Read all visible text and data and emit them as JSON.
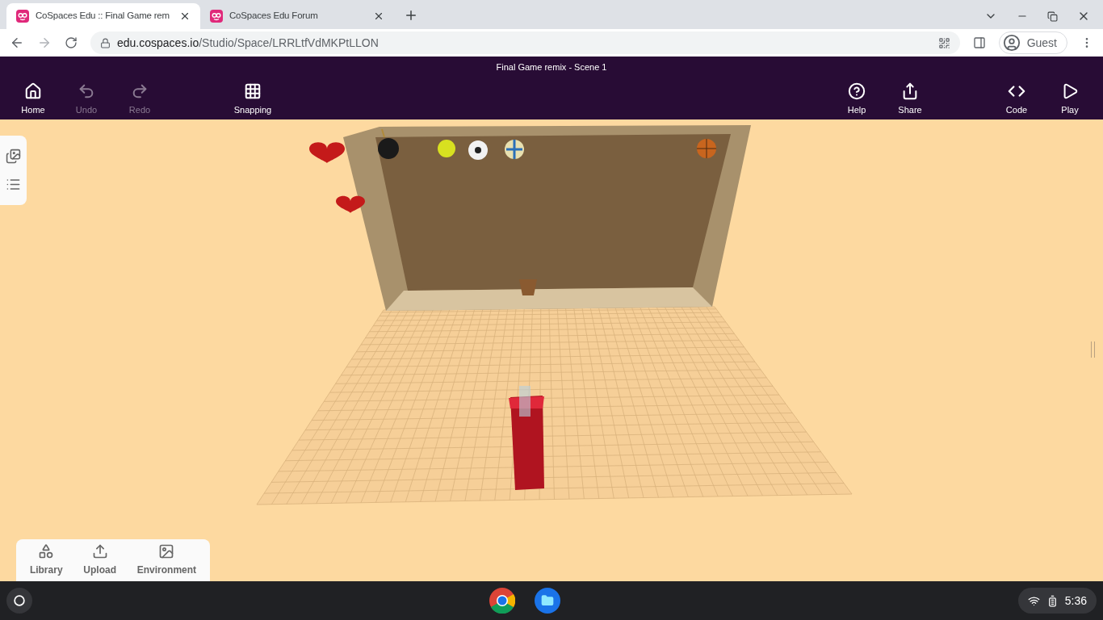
{
  "browser": {
    "tabs": [
      {
        "title": "CoSpaces Edu :: Final Game rem",
        "selected": true
      },
      {
        "title": "CoSpaces Edu Forum",
        "selected": false
      }
    ],
    "address": {
      "host": "edu.cospaces.io",
      "path": "/Studio/Space/LRRLtfVdMKPtLLON"
    },
    "profile": "Guest"
  },
  "app": {
    "title": "Final Game remix - Scene 1",
    "toolbar": [
      {
        "kind": "home",
        "label": "Home",
        "disabled": false
      },
      {
        "kind": "undo",
        "label": "Undo",
        "disabled": true
      },
      {
        "kind": "redo",
        "label": "Redo",
        "disabled": true
      },
      {
        "kind": "snapping",
        "label": "Snapping",
        "disabled": false
      },
      {
        "kind": "help",
        "label": "Help",
        "disabled": false
      },
      {
        "kind": "share",
        "label": "Share",
        "disabled": false
      },
      {
        "kind": "code",
        "label": "Code",
        "disabled": false
      },
      {
        "kind": "play",
        "label": "Play",
        "disabled": false
      }
    ],
    "bottom_panel": [
      {
        "kind": "library",
        "label": "Library"
      },
      {
        "kind": "upload",
        "label": "Upload"
      },
      {
        "kind": "environment",
        "label": "Environment"
      }
    ]
  },
  "taskbar": {
    "time": "5:36"
  }
}
